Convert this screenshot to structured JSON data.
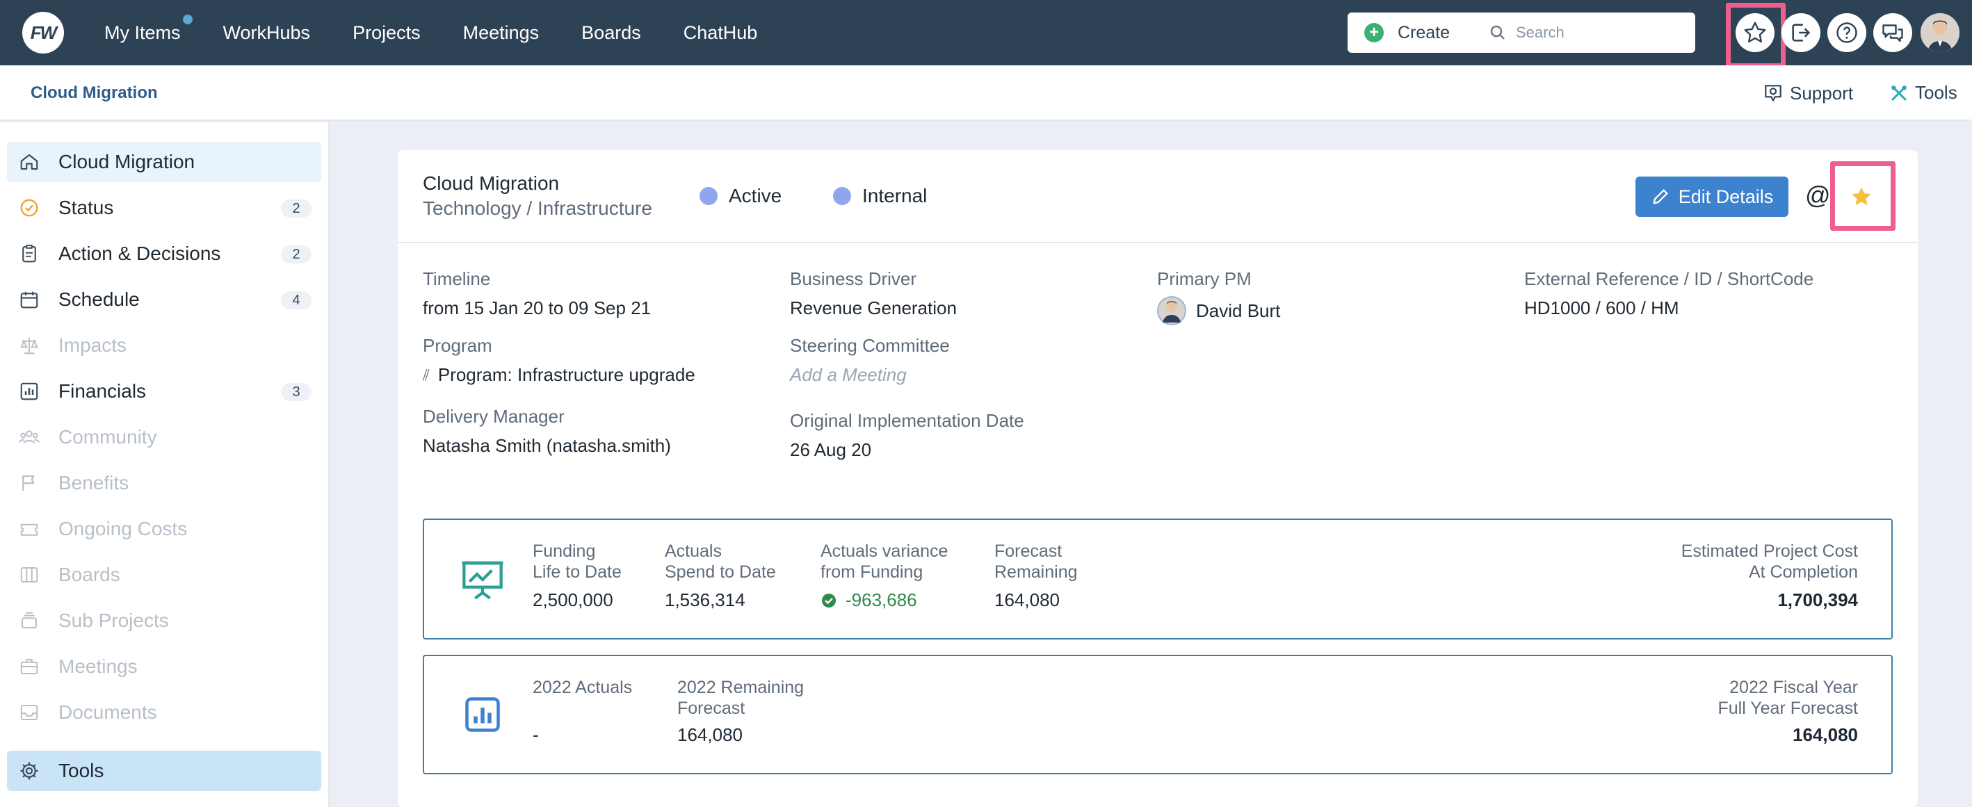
{
  "topbar": {
    "logo_text": "FW",
    "nav": [
      "My Items",
      "WorkHubs",
      "Projects",
      "Meetings",
      "Boards",
      "ChatHub"
    ],
    "create_label": "Create",
    "search_placeholder": "Search",
    "icons": [
      "star-icon",
      "export-icon",
      "help-icon",
      "chat-icon"
    ]
  },
  "subheader": {
    "title": "Cloud Migration",
    "support_label": "Support",
    "tools_label": "Tools"
  },
  "sidebar": {
    "items": [
      {
        "label": "Cloud Migration",
        "icon": "home-icon",
        "badge": ""
      },
      {
        "label": "Status",
        "icon": "status-icon",
        "badge": "2"
      },
      {
        "label": "Action & Decisions",
        "icon": "clipboard-icon",
        "badge": "2"
      },
      {
        "label": "Schedule",
        "icon": "calendar-icon",
        "badge": "4"
      },
      {
        "label": "Impacts",
        "icon": "scales-icon",
        "badge": ""
      },
      {
        "label": "Financials",
        "icon": "chart-icon",
        "badge": "3"
      },
      {
        "label": "Community",
        "icon": "people-icon",
        "badge": ""
      },
      {
        "label": "Benefits",
        "icon": "flag-icon",
        "badge": ""
      },
      {
        "label": "Ongoing Costs",
        "icon": "ticket-icon",
        "badge": ""
      },
      {
        "label": "Boards",
        "icon": "columns-icon",
        "badge": ""
      },
      {
        "label": "Sub Projects",
        "icon": "stack-icon",
        "badge": ""
      },
      {
        "label": "Meetings",
        "icon": "briefcase-icon",
        "badge": ""
      },
      {
        "label": "Documents",
        "icon": "inbox-icon",
        "badge": ""
      },
      {
        "label": "Tools",
        "icon": "gear-icon",
        "badge": ""
      }
    ]
  },
  "project": {
    "name": "Cloud Migration",
    "category": "Technology / Infrastructure",
    "status": "Active",
    "visibility": "Internal",
    "edit_label": "Edit Details",
    "at_symbol": "@"
  },
  "details": {
    "timeline_label": "Timeline",
    "timeline_value": "from 15 Jan 20 to 09 Sep 21",
    "program_label": "Program",
    "program_value": "Program: Infrastructure upgrade",
    "delivery_label": "Delivery Manager",
    "delivery_value": "Natasha Smith (natasha.smith)",
    "driver_label": "Business Driver",
    "driver_value": "Revenue Generation",
    "steering_label": "Steering Committee",
    "steering_value": "Add a Meeting",
    "orig_label": "Original Implementation Date",
    "orig_value": "26 Aug 20",
    "pm_label": "Primary PM",
    "pm_value": "David Burt",
    "extref_label": "External Reference / ID / ShortCode",
    "extref_value": "HD1000 / 600 / HM"
  },
  "financials": {
    "funding_label_1": "Funding",
    "funding_label_2": "Life to Date",
    "funding_value": "2,500,000",
    "actuals_label_1": "Actuals",
    "actuals_label_2": "Spend to Date",
    "actuals_value": "1,536,314",
    "variance_label_1": "Actuals variance",
    "variance_label_2": "from Funding",
    "variance_value": "-963,686",
    "forecast_label_1": "Forecast",
    "forecast_label_2": "Remaining",
    "forecast_value": "164,080",
    "estimate_label_1": "Estimated Project Cost",
    "estimate_label_2": "At Completion",
    "estimate_value": "1,700,394"
  },
  "fiscal": {
    "actuals_label": "2022 Actuals",
    "actuals_value": "-",
    "remaining_label_1": "2022 Remaining",
    "remaining_label_2": "Forecast",
    "remaining_value": "164,080",
    "fy_label_1": "2022 Fiscal Year",
    "fy_label_2": "Full Year Forecast",
    "fy_value": "164,080"
  },
  "colors": {
    "topbar": "#2e4256",
    "accent": "#3d82cf",
    "highlight": "#ec5f8e",
    "star": "#f5c13a",
    "positive": "#2f8a4c"
  }
}
